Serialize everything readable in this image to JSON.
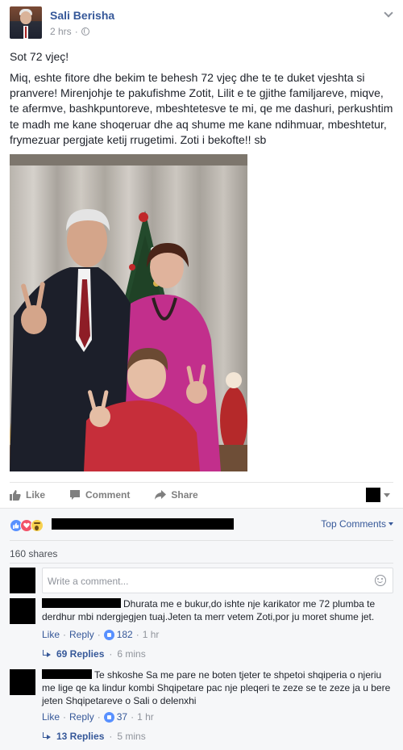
{
  "post": {
    "author": "Sali Berisha",
    "time": "2 hrs",
    "separator": "·",
    "title": "Sot 72 vjeç!",
    "body": "Miq, eshte fitore dhe bekim te behesh 72 vjeç dhe te te duket vjeshta si pranvere! Mirenjohje te pakufishme Zotit, Lilit e te gjithe familjareve, miqve, te afermve, bashkpuntoreve, mbeshtetesve te mi, qe me dashuri, perkushtim te madh me kane shoqeruar dhe aq shume me kane ndihmuar, mbeshtetur, frymezuar pergjate ketij rrugetimi. Zoti i bekofte!! sb"
  },
  "actions": {
    "like": "Like",
    "comment": "Comment",
    "share": "Share"
  },
  "feedback": {
    "top_comments": "Top Comments",
    "shares": "160 shares",
    "composer_placeholder": "Write a comment..."
  },
  "comments": [
    {
      "text": "Dhurata me e bukur,do ishte nje karikator me 72 plumba te derdhur mbi ndergjegjen tuaj.Jeten ta merr vetem Zoti,por ju moret shume jet.",
      "like": "Like",
      "reply": "Reply",
      "likes": "182",
      "time": "1 hr",
      "replies": "69 Replies",
      "replies_time": "6 mins"
    },
    {
      "text": "Te shkoshe Sa me pare ne boten tjeter te shpetoi shqiperia o njeriu me lige qe ka lindur kombi Shqipetare pac nje pleqeri te zeze se te zeze ja u bere jeten Shqipetareve o Sali o delenxhi",
      "like": "Like",
      "reply": "Reply",
      "likes": "37",
      "time": "1 hr",
      "replies": "13 Replies",
      "replies_time": "5 mins"
    }
  ],
  "colors": {
    "link": "#365899",
    "meta": "#90949c",
    "text": "#1d2129",
    "like_blue": "#5890ff",
    "love_red": "#f25268",
    "wow_yellow": "#f7d14f"
  }
}
